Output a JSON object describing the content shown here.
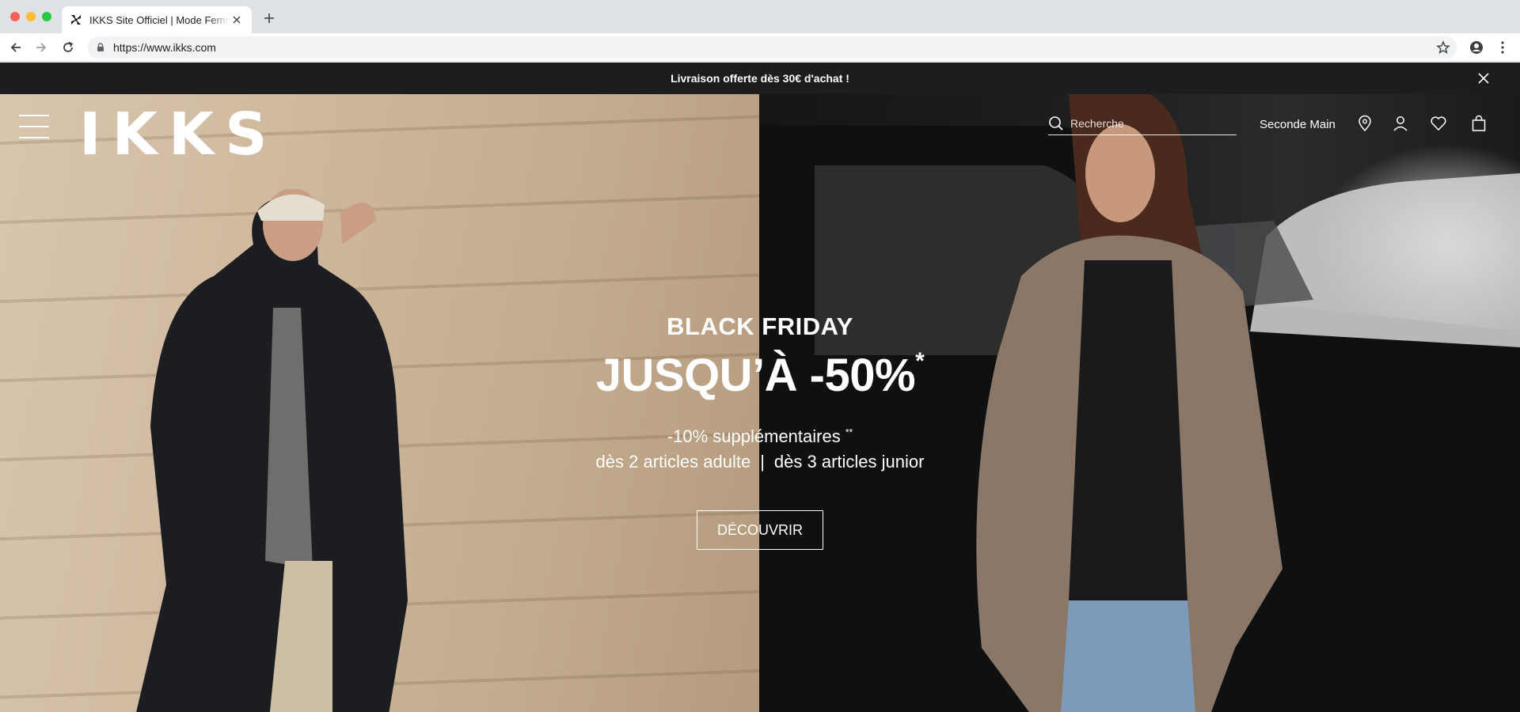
{
  "browser": {
    "tab_title": "IKKS Site Officiel | Mode Femme",
    "url": "https://www.ikks.com"
  },
  "promo": {
    "message": "Livraison offerte dès 30€ d'achat !"
  },
  "header": {
    "logo": "IKKS",
    "search_placeholder": "Recherche",
    "seconde_main": "Seconde Main"
  },
  "hero": {
    "eyebrow": "BLACK FRIDAY",
    "headline": "JUSQU’À -50%",
    "headline_mark": "*",
    "extra_line1": "-10% supplémentaires",
    "extra_line1_mark": "**",
    "extra_adult": "dès 2 articles adulte",
    "extra_separator": "|",
    "extra_junior": "dès 3 articles junior",
    "cta": "DÉCOUVRIR"
  },
  "colors": {
    "promo_bg": "#1d1d1f",
    "text_on_hero": "#ffffff"
  },
  "icons": {
    "menu": "hamburger-icon",
    "search": "search-icon",
    "account": "user-icon",
    "wishlist": "heart-icon",
    "bag": "shopping-bag-icon",
    "store": "location-pin-icon",
    "promo_close": "close-icon"
  }
}
